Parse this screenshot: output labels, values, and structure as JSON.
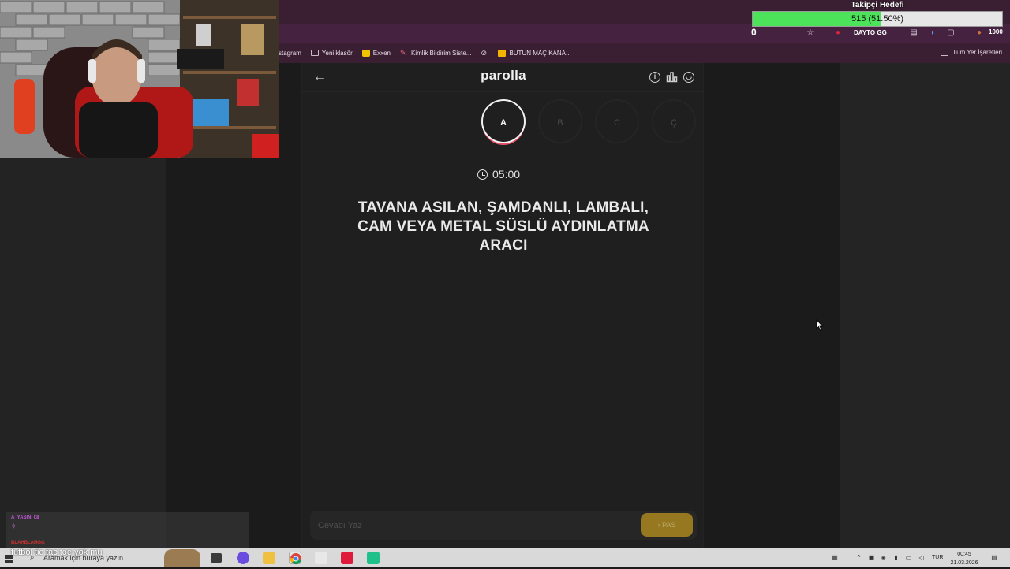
{
  "browser": {
    "bookmarks": [
      "stagram",
      "Yeni klasör",
      "Exxen",
      "Kimlik Bildirim Siste...",
      "BÜTÜN MAÇ KANA..."
    ],
    "bookmarks_all": "Tüm Yer İşaretleri",
    "extension_label": "DAYTO GG",
    "profile_count": "1000"
  },
  "follower_goal": {
    "title": "Takipçi Hedefi",
    "progress_text": "515 (51.50%)",
    "progress_fraction": 0.515,
    "start": "0",
    "end": "1000"
  },
  "app": {
    "logo": "parolla",
    "letters": [
      {
        "label": "A",
        "state": "active"
      },
      {
        "label": "B",
        "state": "idle"
      },
      {
        "label": "C",
        "state": "idle"
      },
      {
        "label": "Ç",
        "state": "idle"
      }
    ],
    "timer": "05:00",
    "question": "TAVANA ASILAN, ŞAMDANLI, LAMBALI, CAM VEYA METAL SÜSLÜ AYDINLATMA ARACI",
    "answer_placeholder": "Cevabı Yaz",
    "pass_label": "PAS"
  },
  "chat": {
    "user1": "A_YASIN_08",
    "user2": "BLAHBLAHGG",
    "message": "futbol tic tac toe yok mu"
  },
  "taskbar": {
    "search_placeholder": "Aramak için buraya yazın",
    "language": "TUR",
    "time": "00:45",
    "date": "21.03.2026"
  }
}
